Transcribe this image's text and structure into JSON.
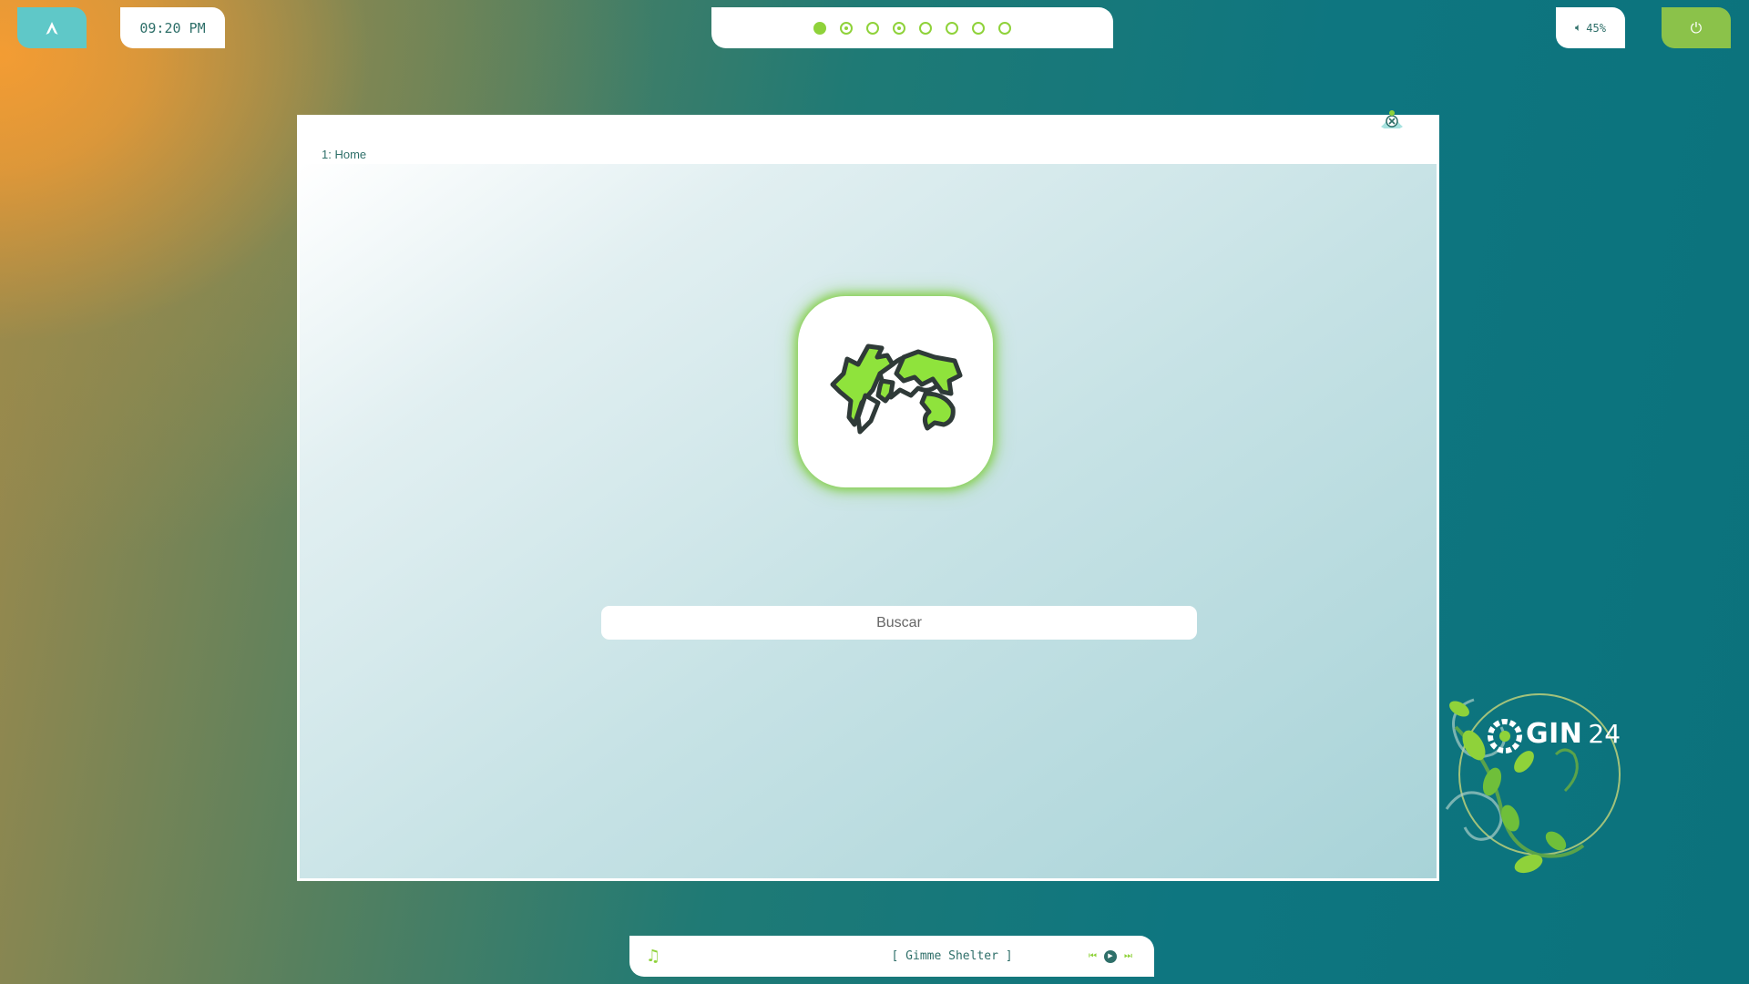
{
  "topbar": {
    "clock": "09:20 PM",
    "workspaces": [
      {
        "state": "active"
      },
      {
        "state": "occupied"
      },
      {
        "state": "empty"
      },
      {
        "state": "occupied"
      },
      {
        "state": "empty"
      },
      {
        "state": "empty"
      },
      {
        "state": "empty"
      },
      {
        "state": "empty"
      }
    ],
    "volume": {
      "icon": "speaker-icon",
      "label": "45%",
      "level": 0.45
    },
    "launcher_icon": "arch-logo-icon",
    "power_icon": "power-icon"
  },
  "window": {
    "title": "1: Home",
    "app_icon": "world-map-icon",
    "search": {
      "placeholder": "Buscar",
      "value": ""
    }
  },
  "wallpaper_logo": {
    "brand": "GIN",
    "number": "24"
  },
  "player": {
    "icon": "music-note-icon",
    "title": "[ Gimme Shelter ]",
    "controls": [
      "prev-icon",
      "play-icon",
      "next-icon"
    ]
  },
  "colors": {
    "accent": "#8fd23a",
    "text": "#2e6f69",
    "launcher": "#5fc8c8",
    "power": "#8bc24a"
  }
}
